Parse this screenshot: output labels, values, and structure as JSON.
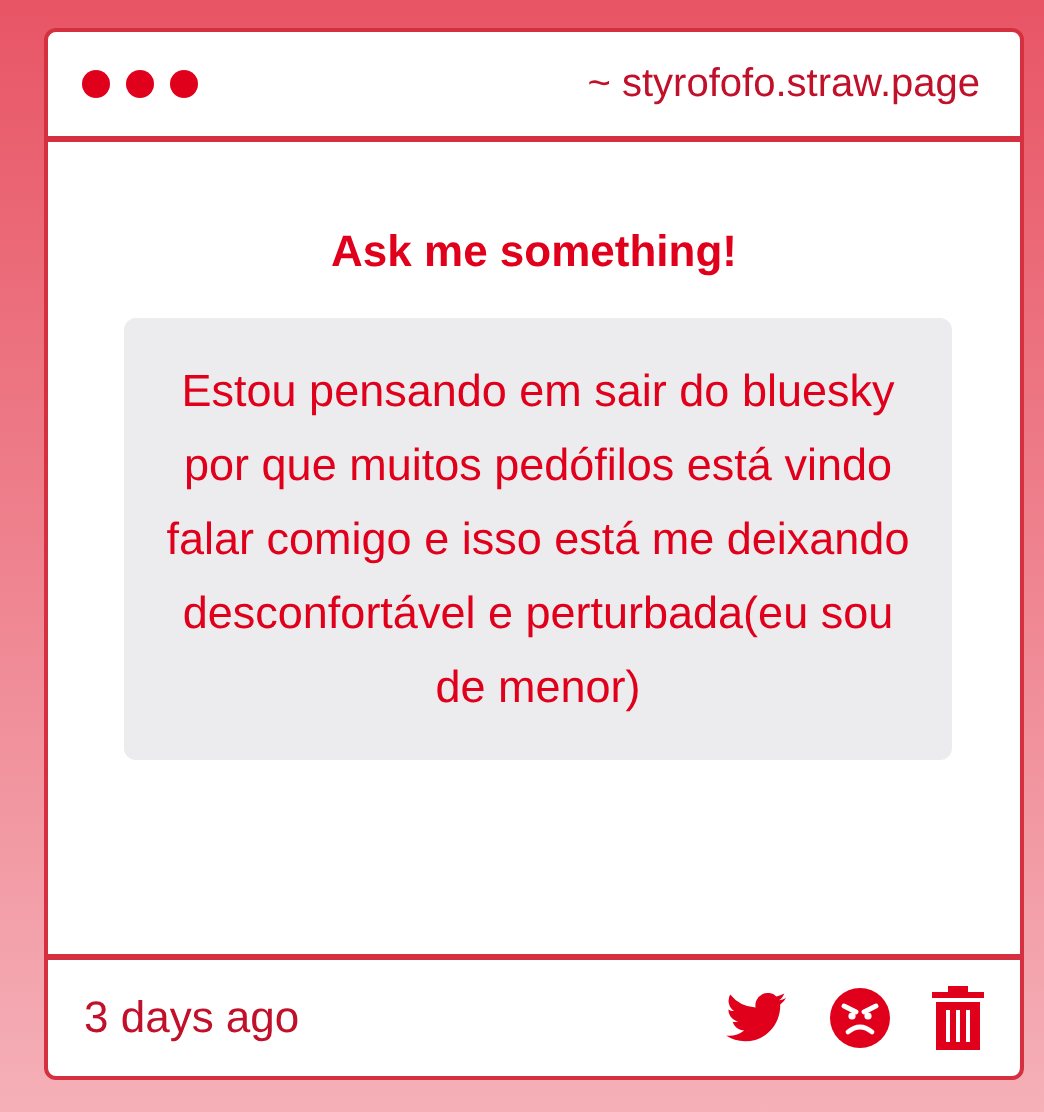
{
  "window": {
    "address": "~ styrofofo.straw.page"
  },
  "title": "Ask me something!",
  "message": "Estou pensando em sair do bluesky por que muitos pedófilos está vindo falar comigo e isso está me deixando desconfortável e perturbada(eu sou de menor)",
  "footer": {
    "time": "3 days ago"
  }
}
